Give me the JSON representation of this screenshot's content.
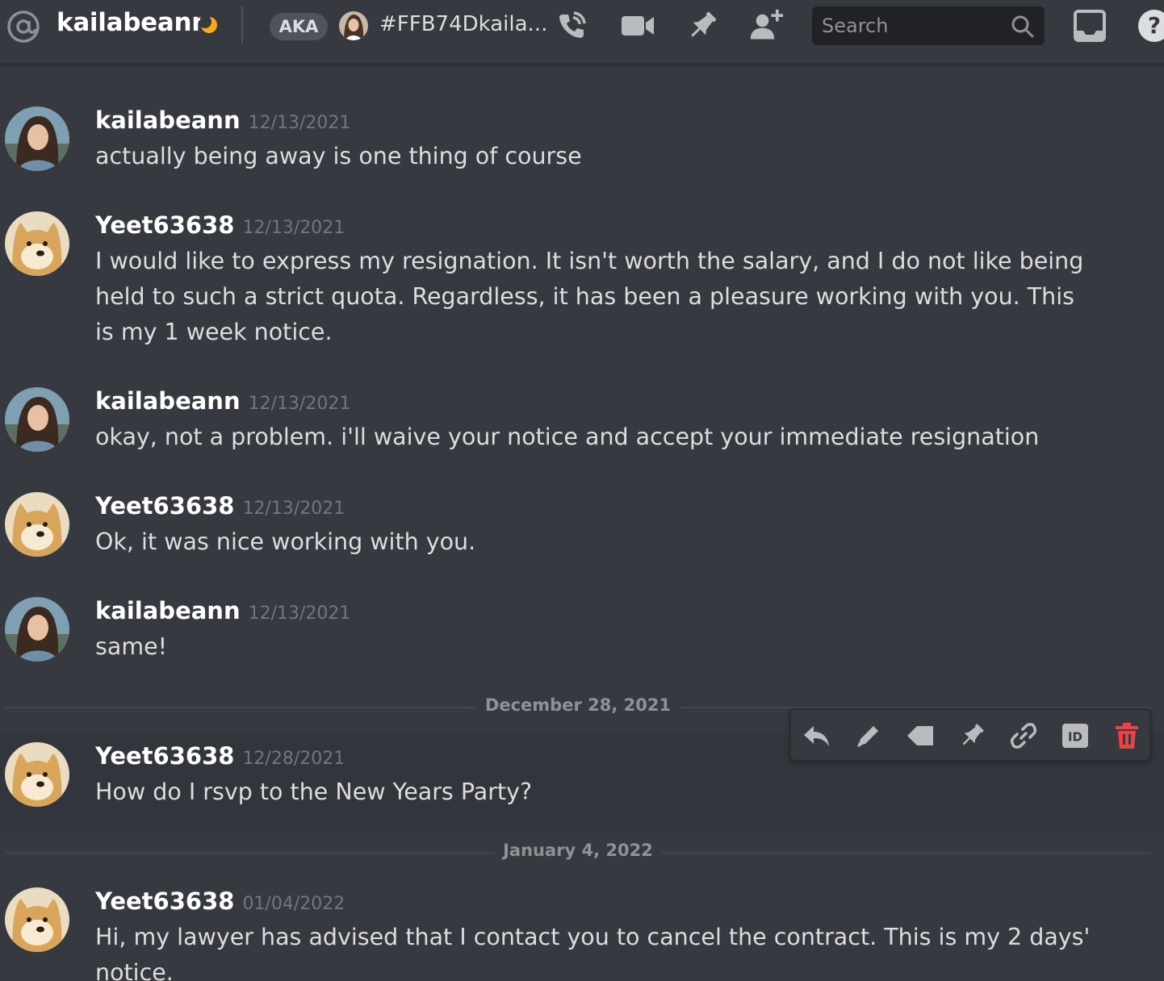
{
  "header": {
    "username": "kailabeann",
    "aka_label": "AKA",
    "nickname": "#FFB74Dkaila...",
    "search_placeholder": "Search",
    "help_label": "?",
    "icons": [
      "at-icon",
      "moon-icon",
      "phone-call-icon",
      "video-call-icon",
      "pin-icon",
      "add-friend-icon",
      "search-icon",
      "inbox-icon",
      "help-icon"
    ]
  },
  "messages": [
    {
      "author": "kailabeann",
      "timestamp": "12/13/2021",
      "avatar": "user-photo-avatar",
      "text": "actually being away is one thing of course"
    },
    {
      "author": "Yeet63638",
      "timestamp": "12/13/2021",
      "avatar": "doge-avatar",
      "text": "I would like to express my resignation. It isn't worth the salary, and I do not like being held to such a strict quota. Regardless, it has been a pleasure working with you. This is my 1 week notice."
    },
    {
      "author": "kailabeann",
      "timestamp": "12/13/2021",
      "avatar": "user-photo-avatar",
      "text": "okay, not a problem. i'll waive your notice and accept your immediate resignation"
    },
    {
      "author": "Yeet63638",
      "timestamp": "12/13/2021",
      "avatar": "doge-avatar",
      "text": "Ok, it was nice working with you."
    },
    {
      "author": "kailabeann",
      "timestamp": "12/13/2021",
      "avatar": "user-photo-avatar",
      "text": "same!"
    },
    {
      "author": "Yeet63638",
      "timestamp": "12/28/2021",
      "avatar": "doge-avatar",
      "text": "How do I rsvp to the New Years Party?"
    },
    {
      "author": "Yeet63638",
      "timestamp": "01/04/2022",
      "avatar": "doge-avatar",
      "text": "Hi, my lawyer has advised that I contact you to cancel the contract. This is my 2 days' notice."
    }
  ],
  "date_dividers": [
    "December 28, 2021",
    "January 4, 2022"
  ],
  "toolbar": {
    "actions": [
      "reply-icon",
      "edit-icon",
      "tag-icon",
      "pin-icon",
      "link-icon",
      "copy-id-icon",
      "delete-icon"
    ],
    "id_label": "ID",
    "delete_color": "#ed4245"
  },
  "colors": {
    "background": "#36393f",
    "text": "#dcddde",
    "muted": "#72767d",
    "status_idle": "#faa81a"
  }
}
